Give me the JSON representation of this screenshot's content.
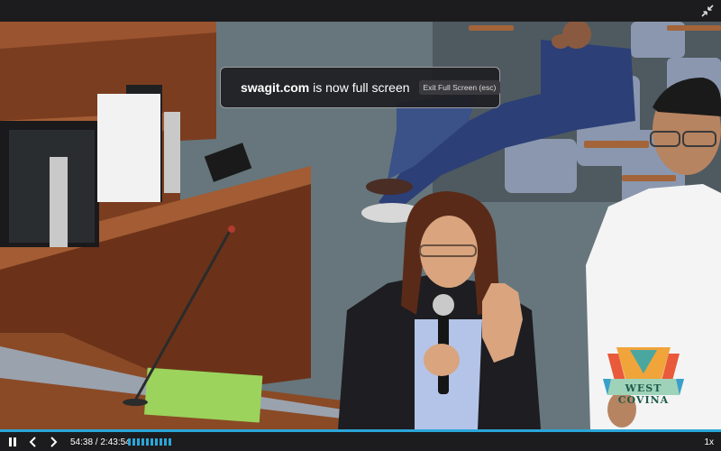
{
  "notice": {
    "domain_text": "swagit.com",
    "message_text": " is now full screen",
    "exit_button_label": "Exit Full Screen (esc)"
  },
  "player": {
    "current_time": "54:38",
    "separator": " / ",
    "duration": "2:43:54",
    "speed_label": "1x",
    "volume_level": 0.6,
    "accent_color": "#2aa6d8"
  },
  "watermark": {
    "text": "WEST COVINA"
  },
  "icons": {
    "pause": "pause-icon",
    "back": "chevron-left-icon",
    "forward": "chevron-right-icon",
    "exit_fullscreen": "exit-fullscreen-icon",
    "lock": "lock-icon"
  }
}
